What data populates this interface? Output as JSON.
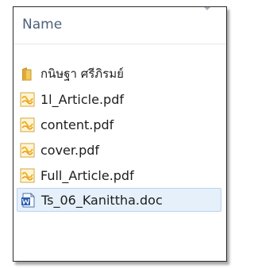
{
  "column_header": {
    "label": "Name"
  },
  "files": [
    {
      "name": "กนิษฐา ศรีภิรมย์",
      "type": "folder",
      "icon": "folder-icon"
    },
    {
      "name": "1l_Article.pdf",
      "type": "pdf",
      "icon": "pdf-file-icon"
    },
    {
      "name": "content.pdf",
      "type": "pdf",
      "icon": "pdf-file-icon"
    },
    {
      "name": "cover.pdf",
      "type": "pdf",
      "icon": "pdf-file-icon"
    },
    {
      "name": "Full_Article.pdf",
      "type": "pdf",
      "icon": "pdf-file-icon"
    },
    {
      "name": "Ts_06_Kanittha.doc",
      "type": "doc",
      "icon": "word-doc-icon",
      "selected": true
    }
  ],
  "colors": {
    "header_text": "#4c607a",
    "selection_fill": "#e6f0fb",
    "selection_border": "#b8d3f0",
    "folder": "#e8b94a",
    "pdf": "#f1c850",
    "word": "#2a5fb0"
  }
}
